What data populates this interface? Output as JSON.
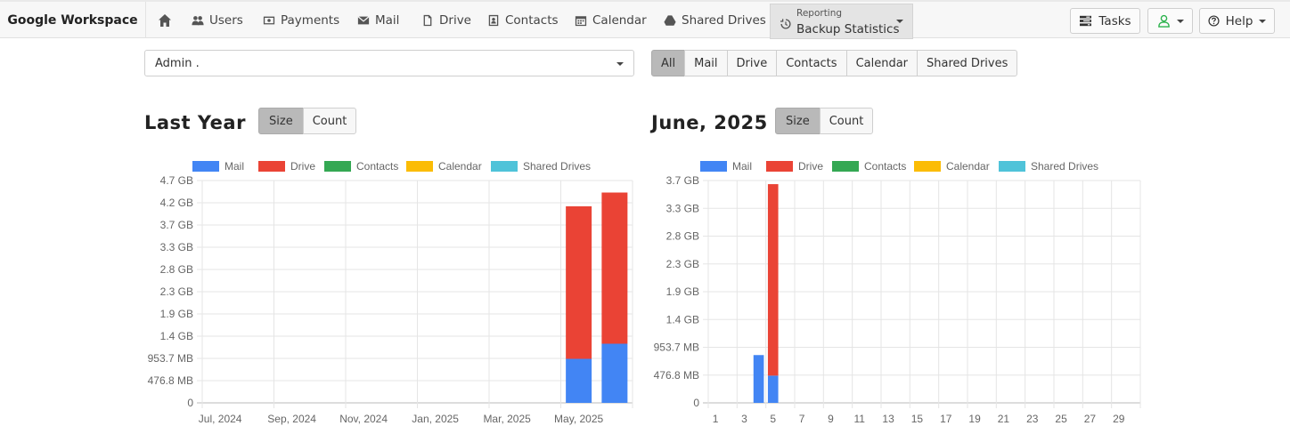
{
  "navbar": {
    "brand": "Google Workspace",
    "items": [
      {
        "label": "Users",
        "icon": "users-icon"
      },
      {
        "label": "Payments",
        "icon": "money-icon"
      },
      {
        "label": "Mail",
        "icon": "envelope-icon"
      },
      {
        "label": "Drive",
        "icon": "file-icon"
      },
      {
        "label": "Contacts",
        "icon": "contact-card-icon"
      },
      {
        "label": "Calendar",
        "icon": "calendar-icon"
      },
      {
        "label": "Shared Drives",
        "icon": "drive-icon"
      }
    ],
    "reporting": {
      "small": "Reporting",
      "label": "Backup Statistics"
    },
    "tasks": "Tasks",
    "help": "Help"
  },
  "filters": {
    "account_select": "Admin .",
    "service_tabs": [
      "All",
      "Mail",
      "Drive",
      "Contacts",
      "Calendar",
      "Shared Drives"
    ],
    "active_service": "All"
  },
  "colors": {
    "Mail": "#4285f4",
    "Drive": "#ea4335",
    "Contacts": "#34a853",
    "Calendar": "#fbbc05",
    "Shared Drives": "#4fc3d9"
  },
  "left_panel": {
    "title": "Last Year",
    "toggle": [
      "Size",
      "Count"
    ],
    "active_toggle": "Size"
  },
  "right_panel": {
    "title": "June, 2025",
    "toggle": [
      "Size",
      "Count"
    ],
    "active_toggle": "Size"
  },
  "chart_data": [
    {
      "type": "bar",
      "stacked": true,
      "legend": [
        "Mail",
        "Drive",
        "Contacts",
        "Calendar",
        "Shared Drives"
      ],
      "legend_position": "top",
      "ytick_labels": [
        "0",
        "476.8 MB",
        "953.7 MB",
        "1.4 GB",
        "1.9 GB",
        "2.3 GB",
        "2.8 GB",
        "3.3 GB",
        "3.7 GB",
        "4.2 GB",
        "4.7 GB"
      ],
      "xtick_labels": [
        "Jul, 2024",
        "Sep, 2024",
        "Nov, 2024",
        "Jan, 2025",
        "Mar, 2025",
        "May, 2025"
      ],
      "categories": [
        "Jul, 2024",
        "Aug, 2024",
        "Sep, 2024",
        "Oct, 2024",
        "Nov, 2024",
        "Dec, 2024",
        "Jan, 2025",
        "Feb, 2025",
        "Mar, 2025",
        "Apr, 2025",
        "May, 2025",
        "Jun, 2025"
      ],
      "ylim": [
        0,
        10
      ],
      "series": [
        {
          "name": "Mail",
          "values": [
            0,
            0,
            0,
            0,
            0,
            0,
            0,
            0,
            0,
            0,
            1.98,
            2.66
          ]
        },
        {
          "name": "Drive",
          "values": [
            0,
            0,
            0,
            0,
            0,
            0,
            0,
            0,
            0,
            0,
            6.86,
            6.8
          ]
        },
        {
          "name": "Contacts",
          "values": [
            0,
            0,
            0,
            0,
            0,
            0,
            0,
            0,
            0,
            0,
            0,
            0
          ]
        },
        {
          "name": "Calendar",
          "values": [
            0,
            0,
            0,
            0,
            0,
            0,
            0,
            0,
            0,
            0,
            0,
            0
          ]
        },
        {
          "name": "Shared Drives",
          "values": [
            0,
            0,
            0,
            0,
            0,
            0,
            0,
            0,
            0,
            0,
            0,
            0
          ]
        }
      ],
      "grid": true
    },
    {
      "type": "bar",
      "stacked": true,
      "legend": [
        "Mail",
        "Drive",
        "Contacts",
        "Calendar",
        "Shared Drives"
      ],
      "legend_position": "top",
      "ytick_labels": [
        "0",
        "476.8 MB",
        "953.7 MB",
        "1.4 GB",
        "1.9 GB",
        "2.3 GB",
        "2.8 GB",
        "3.3 GB",
        "3.7 GB"
      ],
      "xtick_labels": [
        "1",
        "3",
        "5",
        "7",
        "9",
        "11",
        "13",
        "15",
        "17",
        "19",
        "21",
        "23",
        "25",
        "27",
        "29"
      ],
      "categories": [
        "1",
        "2",
        "3",
        "4",
        "5",
        "6",
        "7",
        "8",
        "9",
        "10",
        "11",
        "12",
        "13",
        "14",
        "15",
        "16",
        "17",
        "18",
        "19",
        "20",
        "21",
        "22",
        "23",
        "24",
        "25",
        "26",
        "27",
        "28",
        "29",
        "30"
      ],
      "ylim": [
        0,
        8
      ],
      "series": [
        {
          "name": "Mail",
          "values": [
            0,
            0,
            0,
            1.72,
            0.98,
            0,
            0,
            0,
            0,
            0,
            0,
            0,
            0,
            0,
            0,
            0,
            0,
            0,
            0,
            0,
            0,
            0,
            0,
            0,
            0,
            0,
            0,
            0,
            0,
            0
          ]
        },
        {
          "name": "Drive",
          "values": [
            0,
            0,
            0,
            0,
            6.89,
            0,
            0,
            0,
            0,
            0,
            0,
            0,
            0,
            0,
            0,
            0,
            0,
            0,
            0,
            0,
            0,
            0,
            0,
            0,
            0,
            0,
            0,
            0,
            0,
            0
          ]
        },
        {
          "name": "Contacts",
          "values": [
            0,
            0,
            0,
            0,
            0,
            0,
            0,
            0,
            0,
            0,
            0,
            0,
            0,
            0,
            0,
            0,
            0,
            0,
            0,
            0,
            0,
            0,
            0,
            0,
            0,
            0,
            0,
            0,
            0,
            0
          ]
        },
        {
          "name": "Calendar",
          "values": [
            0,
            0,
            0,
            0,
            0,
            0,
            0,
            0,
            0,
            0,
            0,
            0,
            0,
            0,
            0,
            0,
            0,
            0,
            0,
            0,
            0,
            0,
            0,
            0,
            0,
            0,
            0,
            0,
            0,
            0
          ]
        },
        {
          "name": "Shared Drives",
          "values": [
            0,
            0,
            0,
            0,
            0,
            0,
            0,
            0,
            0,
            0,
            0,
            0,
            0,
            0,
            0,
            0,
            0,
            0,
            0,
            0,
            0,
            0,
            0,
            0,
            0,
            0,
            0,
            0,
            0,
            0
          ]
        }
      ],
      "grid": true
    }
  ]
}
